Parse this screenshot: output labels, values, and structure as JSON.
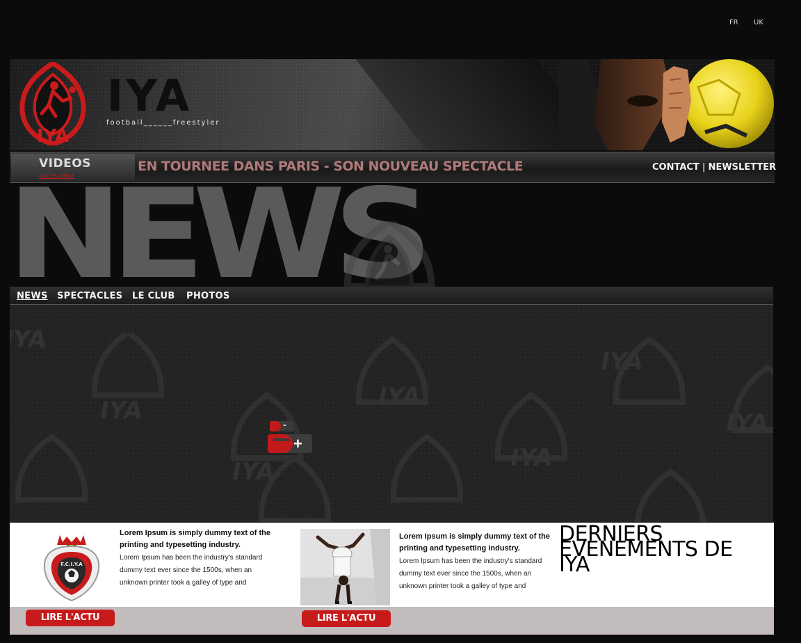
{
  "languages": {
    "fr": "FR",
    "uk": "UK"
  },
  "header": {
    "emblem_text": "IYA",
    "brand": "IYA",
    "tagline": "football______freestyler"
  },
  "subbar": {
    "videos_title": "VIDEOS",
    "videos_link": "voir les videos",
    "marquee": "EN TOURNEE  DANS PARIS - SON NOUVEAU SPECTACLE",
    "contact": "CONTACT",
    "separator": "|",
    "newsletter": "NEWSLETTER"
  },
  "page_title": "NEWS",
  "main_nav": {
    "news": "NEWS",
    "spectacles": "SPECTACLES",
    "club": "LE CLUB",
    "photos": "PHOTOS"
  },
  "watermark_text": "IYA",
  "zoom": {
    "minus": "-",
    "plus": "+"
  },
  "articles": [
    {
      "title": "Lorem Ipsum is simply dummy text of the printing and typesetting industry.",
      "body": " Lorem Ipsum has been the industry's standard dummy text ever since the 1500s, when an unknown printer took a galley of type and scrambled it to make a type specimen book. It",
      "button": "LIRE L'ACTU",
      "crest_text": "F.C.I.Y.A"
    },
    {
      "title": "Lorem Ipsum is simply dummy text of the printing and typesetting industry.",
      "body": " Lorem Ipsum has been the industry's standard dummy text ever since the 1500s, when an unknown printer took a galley of type and scrambled it to make a type specimen book. It",
      "button": "LIRE L'ACTU"
    }
  ],
  "derniers_evenements": "DERNIERS EVENEMENTS DE IYA",
  "colors": {
    "accent_red": "#c71b1b",
    "bg": "#0b0b0b",
    "news_gray": "#5a5a5a"
  }
}
